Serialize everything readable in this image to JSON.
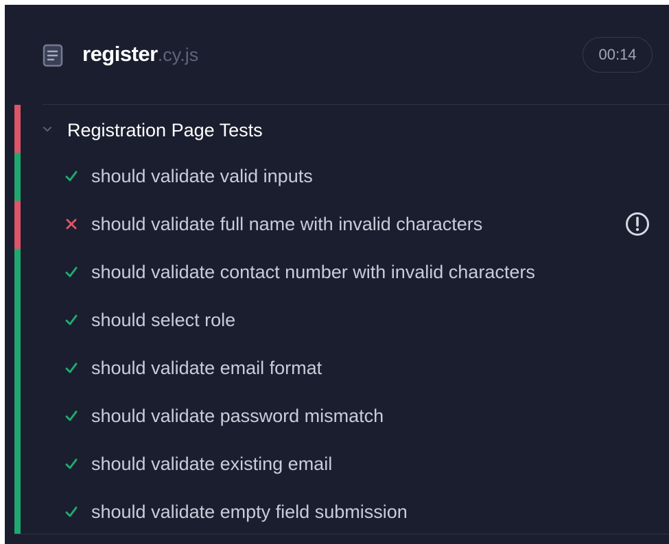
{
  "spec": {
    "file_base": "register",
    "file_ext": ".cy.js",
    "duration": "00:14",
    "icon": "document-icon"
  },
  "suite": {
    "title": "Registration Page Tests",
    "state": "failed",
    "chevron_icon": "chevron-down-icon"
  },
  "tests": [
    {
      "label": "should validate valid inputs",
      "state": "passed"
    },
    {
      "label": "should validate full name with invalid characters",
      "state": "failed"
    },
    {
      "label": "should validate contact number with invalid characters",
      "state": "passed"
    },
    {
      "label": "should select role",
      "state": "passed"
    },
    {
      "label": "should validate email format",
      "state": "passed"
    },
    {
      "label": "should validate password mismatch",
      "state": "passed"
    },
    {
      "label": "should validate existing email",
      "state": "passed"
    },
    {
      "label": "should validate empty field submission",
      "state": "passed"
    }
  ],
  "colors": {
    "passed": "#1fa971",
    "failed": "#dd5566",
    "background": "#1b1e2e"
  }
}
